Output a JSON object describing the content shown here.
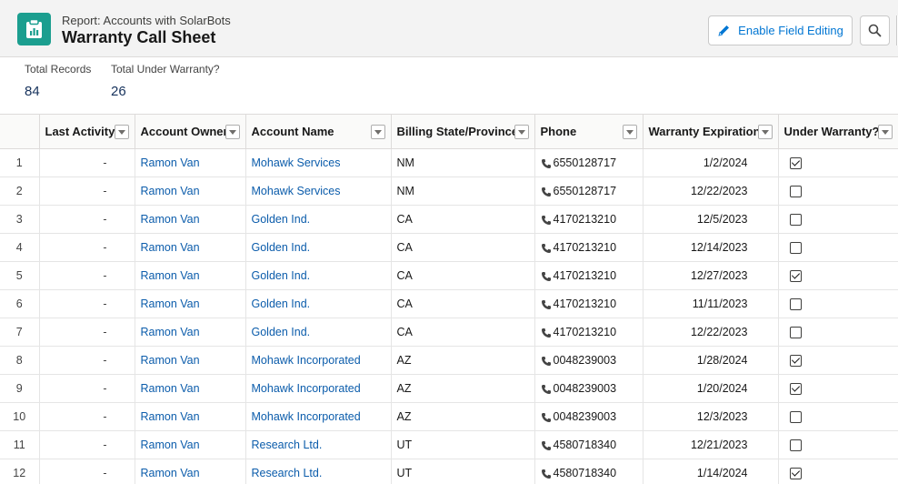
{
  "header": {
    "subtitle": "Report: Accounts with SolarBots",
    "title": "Warranty Call Sheet",
    "icon": "report-clipboard-icon",
    "icon_color": "#1b9e8f",
    "enable_button_label": "Enable Field Editing",
    "search_icon": "search-icon"
  },
  "summary": {
    "total_records_label": "Total Records",
    "total_records_value": "84",
    "under_warranty_label": "Total Under Warranty?",
    "under_warranty_value": "26"
  },
  "table": {
    "columns": [
      "Last Activity",
      "Account Owner",
      "Account Name",
      "Billing State/Province",
      "Phone",
      "Warranty Expiration",
      "Under Warranty?"
    ],
    "rows": [
      {
        "num": "1",
        "activity": "-",
        "owner": "Ramon Van",
        "account": "Mohawk Services",
        "state": "NM",
        "phone": "6550128717",
        "expiration": "1/2/2024",
        "warranty": true
      },
      {
        "num": "2",
        "activity": "-",
        "owner": "Ramon Van",
        "account": "Mohawk Services",
        "state": "NM",
        "phone": "6550128717",
        "expiration": "12/22/2023",
        "warranty": false
      },
      {
        "num": "3",
        "activity": "-",
        "owner": "Ramon Van",
        "account": "Golden Ind.",
        "state": "CA",
        "phone": "4170213210",
        "expiration": "12/5/2023",
        "warranty": false
      },
      {
        "num": "4",
        "activity": "-",
        "owner": "Ramon Van",
        "account": "Golden Ind.",
        "state": "CA",
        "phone": "4170213210",
        "expiration": "12/14/2023",
        "warranty": false
      },
      {
        "num": "5",
        "activity": "-",
        "owner": "Ramon Van",
        "account": "Golden Ind.",
        "state": "CA",
        "phone": "4170213210",
        "expiration": "12/27/2023",
        "warranty": true
      },
      {
        "num": "6",
        "activity": "-",
        "owner": "Ramon Van",
        "account": "Golden Ind.",
        "state": "CA",
        "phone": "4170213210",
        "expiration": "11/11/2023",
        "warranty": false
      },
      {
        "num": "7",
        "activity": "-",
        "owner": "Ramon Van",
        "account": "Golden Ind.",
        "state": "CA",
        "phone": "4170213210",
        "expiration": "12/22/2023",
        "warranty": false
      },
      {
        "num": "8",
        "activity": "-",
        "owner": "Ramon Van",
        "account": "Mohawk Incorporated",
        "state": "AZ",
        "phone": "0048239003",
        "expiration": "1/28/2024",
        "warranty": true
      },
      {
        "num": "9",
        "activity": "-",
        "owner": "Ramon Van",
        "account": "Mohawk Incorporated",
        "state": "AZ",
        "phone": "0048239003",
        "expiration": "1/20/2024",
        "warranty": true
      },
      {
        "num": "10",
        "activity": "-",
        "owner": "Ramon Van",
        "account": "Mohawk Incorporated",
        "state": "AZ",
        "phone": "0048239003",
        "expiration": "12/3/2023",
        "warranty": false
      },
      {
        "num": "11",
        "activity": "-",
        "owner": "Ramon Van",
        "account": "Research Ltd.",
        "state": "UT",
        "phone": "4580718340",
        "expiration": "12/21/2023",
        "warranty": false
      },
      {
        "num": "12",
        "activity": "-",
        "owner": "Ramon Van",
        "account": "Research Ltd.",
        "state": "UT",
        "phone": "4580718340",
        "expiration": "1/14/2024",
        "warranty": true
      }
    ]
  },
  "colors": {
    "link": "#0b5cab",
    "button_text": "#0176d3"
  }
}
